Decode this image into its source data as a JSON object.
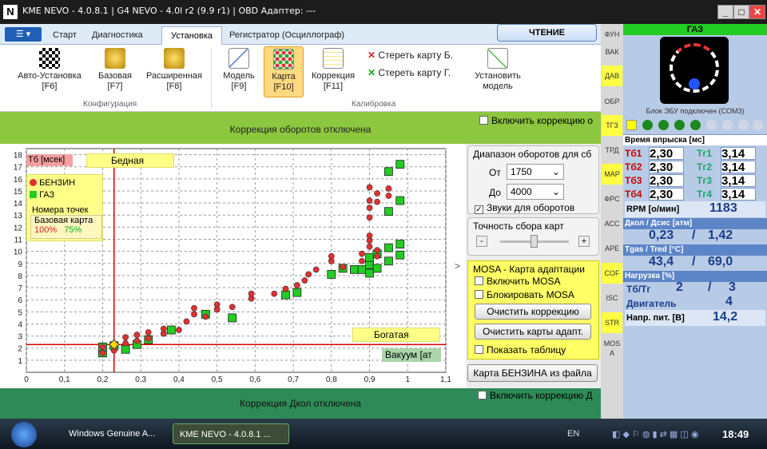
{
  "window": {
    "title": "KME NEVO - 4.0.8.1  |  G4 NEVO - 4.0l r2 (9.9 r1)  |  OBD Адаптер: ---"
  },
  "menu": {
    "tabs": [
      "Старт",
      "Диагностика",
      "Установка",
      "Регистратор (Осциллограф)"
    ],
    "read_label": "ЧТЕНИЕ"
  },
  "ribbon": {
    "config_buttons": [
      {
        "label": "Авто-Установка",
        "key": "[F6]"
      },
      {
        "label": "Базовая",
        "key": "[F7]"
      },
      {
        "label": "Расширенная",
        "key": "[F8]"
      }
    ],
    "calib_buttons": [
      {
        "label": "Модель",
        "key": "[F9]"
      },
      {
        "label": "Карта",
        "key": "[F10]"
      },
      {
        "label": "Коррекция",
        "key": "[F11]"
      }
    ],
    "erase_b": "Стереть карту Б.",
    "erase_g": "Стереть карту Г.",
    "set_model": "Установить",
    "set_model2": "модель",
    "group_config": "Конфигурация",
    "group_calib": "Калибровка"
  },
  "banner_top": {
    "text": "Коррекция оборотов отключена",
    "checkbox": "Включить коррекцию о"
  },
  "banner_bottom": {
    "text": "Коррекция Дкол отключена",
    "checkbox": "Включить коррекцию Д"
  },
  "chart_overlay": {
    "tb": "Тб [мсек]",
    "lean": "Бедная",
    "rich": "Богатая",
    "vacuum": "Вакуум [ат",
    "legend_benz": "БЕНЗИН",
    "legend_gas": "ГАЗ",
    "points_hdr": "Номера точек",
    "base_map": "Базовая карта",
    "pct1": "100%",
    "pct2": "75%"
  },
  "side": {
    "rpm_range": "Диапазон оборотов для сб",
    "from": "От",
    "from_val": "1750",
    "to": "До",
    "to_val": "4000",
    "sounds": "Звуки для оборотов",
    "accuracy": "Точность сбора карт",
    "mosa_title": "MOSA - Карта адаптации",
    "mosa_enable": "Включить MOSA",
    "mosa_block": "Блокировать MOSA",
    "clear_corr": "Очистить коррекцию",
    "clear_adapt": "Очистить карты адапт.",
    "show_table": "Показать таблицу",
    "petrol_map": "Карта БЕНЗИНА из файла"
  },
  "vtabs": [
    "ФУН",
    "ВАК",
    "ДАВ",
    "ОБР",
    "ТГЗ",
    "ТРД",
    "МАР",
    "ФРС",
    "АСС",
    "АРЕ",
    "COF",
    "ISC",
    "STR",
    "MOS А"
  ],
  "right": {
    "gas": "ГАЗ",
    "ecu": "Блок ЭБУ подключен (COM3)",
    "inj_hdr": "Время впрыска [мс]",
    "tb": [
      {
        "l": "Тб1",
        "v": "2,30"
      },
      {
        "l": "Тб2",
        "v": "2,30"
      },
      {
        "l": "Тб3",
        "v": "2,30"
      },
      {
        "l": "Тб4",
        "v": "2,30"
      }
    ],
    "tg": [
      {
        "l": "Тг1",
        "v": "3,14"
      },
      {
        "l": "Тг2",
        "v": "3,14"
      },
      {
        "l": "Тг3",
        "v": "3,14"
      },
      {
        "l": "Тг4",
        "v": "3,14"
      }
    ],
    "rpm_label": "RPM [о/мин]",
    "rpm": "1183",
    "press_hdr": "Дкол / Дсис [атм]",
    "pcol": "0,23",
    "psep": "/",
    "psys": "1,42",
    "temp_hdr": "Tgas / Tred [°C]",
    "tgas": "43,4",
    "tred": "69,0",
    "load_hdr": "Нагрузка [%]",
    "tbtg": "Тб/Тг",
    "l1": "2",
    "l2": "3",
    "eng": "Двигатель",
    "engv": "4",
    "volt_label": "Напр. пит. [В]",
    "volt": "14,2"
  },
  "taskbar": {
    "item1": "Windows Genuine A...",
    "item2": "KME NEVO - 4.0.8.1 ...",
    "lang": "EN",
    "time": "18:49"
  },
  "chart_data": {
    "type": "scatter",
    "title": "",
    "xlabel": "Вакуум [ат",
    "ylabel": "Тб [мсек]",
    "x_ticks": [
      "0",
      "0,1",
      "0,2",
      "0,3",
      "0,4",
      "0,5",
      "0,6",
      "0,7",
      "0,8",
      "0,9",
      "1",
      "1,1"
    ],
    "y_ticks": [
      "1",
      "2",
      "3",
      "4",
      "5",
      "6",
      "7",
      "8",
      "9",
      "10",
      "11",
      "12",
      "13",
      "14",
      "15",
      "16",
      "17",
      "18"
    ],
    "xlim": [
      0,
      1.1
    ],
    "ylim": [
      0,
      18.5
    ],
    "series": [
      {
        "name": "БЕНЗИН",
        "color": "#e03030",
        "points": [
          [
            0.2,
            1.6
          ],
          [
            0.2,
            2.1
          ],
          [
            0.23,
            1.8
          ],
          [
            0.26,
            2.4
          ],
          [
            0.26,
            2.9
          ],
          [
            0.29,
            2.6
          ],
          [
            0.29,
            3.1
          ],
          [
            0.32,
            2.8
          ],
          [
            0.32,
            3.3
          ],
          [
            0.36,
            3.2
          ],
          [
            0.36,
            3.6
          ],
          [
            0.4,
            3.5
          ],
          [
            0.42,
            4.2
          ],
          [
            0.44,
            4.8
          ],
          [
            0.44,
            5.3
          ],
          [
            0.47,
            4.6
          ],
          [
            0.5,
            5.2
          ],
          [
            0.5,
            5.6
          ],
          [
            0.54,
            5.4
          ],
          [
            0.59,
            6.1
          ],
          [
            0.59,
            6.5
          ],
          [
            0.65,
            6.5
          ],
          [
            0.68,
            6.9
          ],
          [
            0.71,
            7.2
          ],
          [
            0.73,
            7.6
          ],
          [
            0.74,
            8.1
          ],
          [
            0.76,
            8.5
          ],
          [
            0.8,
            9.2
          ],
          [
            0.8,
            9.6
          ],
          [
            0.83,
            8.7
          ],
          [
            0.88,
            9.2
          ],
          [
            0.88,
            9.8
          ],
          [
            0.9,
            10.4
          ],
          [
            0.9,
            10.9
          ],
          [
            0.9,
            11.3
          ],
          [
            0.92,
            10.1
          ],
          [
            0.92,
            9.6
          ],
          [
            0.9,
            12.8
          ],
          [
            0.9,
            13.6
          ],
          [
            0.9,
            14.2
          ],
          [
            0.9,
            15.3
          ],
          [
            0.92,
            14.8
          ],
          [
            0.92,
            14.1
          ],
          [
            0.95,
            14.6
          ],
          [
            0.95,
            15.2
          ]
        ]
      },
      {
        "name": "ГАЗ",
        "color": "#22cc22",
        "points": [
          [
            0.2,
            1.6
          ],
          [
            0.2,
            2.1
          ],
          [
            0.23,
            2.2
          ],
          [
            0.26,
            1.9
          ],
          [
            0.29,
            2.3
          ],
          [
            0.32,
            2.7
          ],
          [
            0.38,
            3.5
          ],
          [
            0.47,
            4.8
          ],
          [
            0.54,
            4.5
          ],
          [
            0.68,
            6.4
          ],
          [
            0.71,
            6.6
          ],
          [
            0.8,
            8.1
          ],
          [
            0.83,
            8.6
          ],
          [
            0.86,
            8.5
          ],
          [
            0.88,
            8.5
          ],
          [
            0.9,
            8.2
          ],
          [
            0.9,
            8.9
          ],
          [
            0.9,
            9.5
          ],
          [
            0.92,
            9.8
          ],
          [
            0.92,
            8.6
          ],
          [
            0.95,
            9.2
          ],
          [
            0.95,
            10.3
          ],
          [
            0.98,
            9.7
          ],
          [
            0.98,
            10.6
          ],
          [
            0.95,
            16.6
          ],
          [
            0.98,
            17.2
          ],
          [
            0.95,
            13.3
          ],
          [
            0.98,
            14.2
          ]
        ]
      }
    ],
    "crosshair": {
      "x": 0.23,
      "y": 2.3
    }
  }
}
